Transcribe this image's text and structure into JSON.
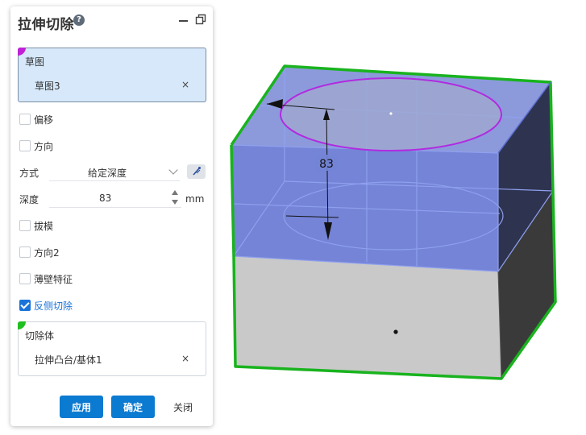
{
  "panel": {
    "title": "拉伸切除",
    "help_glyph": "?"
  },
  "sketch_selection": {
    "label": "草图",
    "item": "草图3",
    "remove_glyph": "×",
    "tag_color": "#c021d6"
  },
  "options": {
    "offset": {
      "label": "偏移",
      "checked": false
    },
    "direction": {
      "label": "方向",
      "checked": false
    }
  },
  "method": {
    "label": "方式",
    "value": "给定深度"
  },
  "depth": {
    "label": "深度",
    "value": "83",
    "unit": "mm"
  },
  "options2": {
    "draft": {
      "label": "拔模",
      "checked": false
    },
    "direction2": {
      "label": "方向2",
      "checked": false
    },
    "thin_feature": {
      "label": "薄壁特征",
      "checked": false
    },
    "flip_side": {
      "label": "反侧切除",
      "checked": true
    }
  },
  "body_selection": {
    "label": "切除体",
    "item": "拉伸凸台/基体1",
    "remove_glyph": "×",
    "tag_color": "#1fbf1f"
  },
  "buttons": {
    "apply": "应用",
    "ok": "确定",
    "close": "关闭"
  },
  "viewport": {
    "dimension_label": "83",
    "colors": {
      "edge_highlight": "#19b31e",
      "preview_fill": "#5d6fd0",
      "sketch_circle": "#b12be0"
    }
  }
}
